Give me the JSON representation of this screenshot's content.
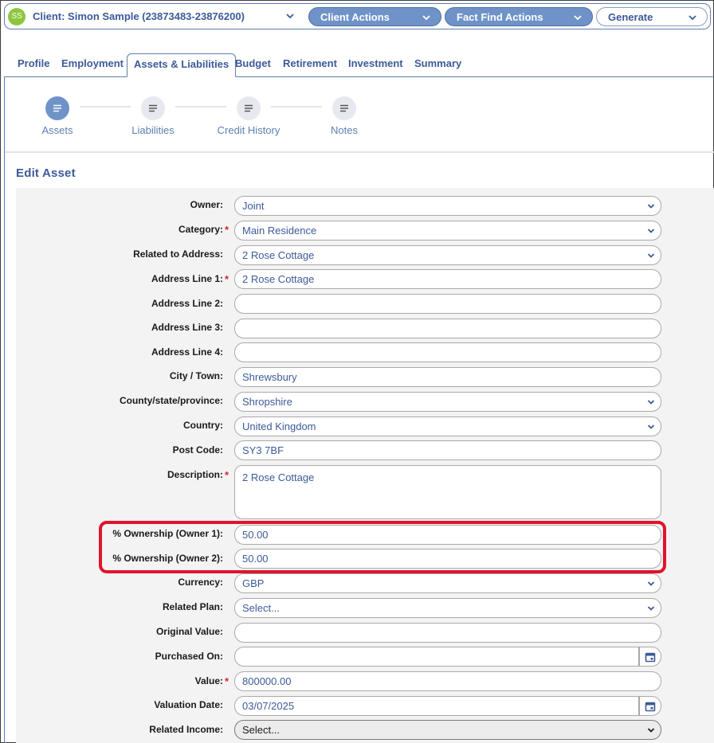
{
  "header": {
    "avatar_initials": "SS",
    "client_label": "Client: Simon Sample (23873483-23876200)",
    "client_actions": "Client Actions",
    "fact_find_actions": "Fact Find Actions",
    "generate": "Generate",
    "accent_color": "#6f93c8"
  },
  "tabs": [
    {
      "label": "Profile",
      "active": false
    },
    {
      "label": "Employment",
      "active": false
    },
    {
      "label": "Assets & Liabilities",
      "active": true
    },
    {
      "label": "Budget",
      "active": false
    },
    {
      "label": "Retirement",
      "active": false
    },
    {
      "label": "Investment",
      "active": false
    },
    {
      "label": "Summary",
      "active": false
    }
  ],
  "stepper": [
    {
      "label": "Assets",
      "icon": "list-icon",
      "active": true
    },
    {
      "label": "Liabilities",
      "icon": "list-icon",
      "active": false
    },
    {
      "label": "Credit History",
      "icon": "list-icon",
      "active": false
    },
    {
      "label": "Notes",
      "icon": "list-icon",
      "active": false
    }
  ],
  "form": {
    "title": "Edit Asset",
    "fields": {
      "owner": {
        "label": "Owner:",
        "value": "Joint"
      },
      "category": {
        "label": "Category:",
        "value": "Main Residence",
        "required": "*"
      },
      "related_address": {
        "label": "Related to Address:",
        "value": "2 Rose Cottage"
      },
      "address1": {
        "label": "Address Line 1:",
        "value": "2 Rose Cottage",
        "required": "*"
      },
      "address2": {
        "label": "Address Line 2:",
        "value": ""
      },
      "address3": {
        "label": "Address Line 3:",
        "value": ""
      },
      "address4": {
        "label": "Address Line 4:",
        "value": ""
      },
      "city": {
        "label": "City / Town:",
        "value": "Shrewsbury"
      },
      "county": {
        "label": "County/state/province:",
        "value": "Shropshire"
      },
      "country": {
        "label": "Country:",
        "value": "United Kingdom"
      },
      "postcode": {
        "label": "Post Code:",
        "value": "SY3 7BF"
      },
      "description": {
        "label": "Description:",
        "value": "2 Rose Cottage",
        "required": "*"
      },
      "ownership1": {
        "label": "% Ownership (Owner 1):",
        "value": "50.00"
      },
      "ownership2": {
        "label": "% Ownership (Owner 2):",
        "value": "50.00"
      },
      "currency": {
        "label": "Currency:",
        "value": "GBP"
      },
      "related_plan": {
        "label": "Related Plan:",
        "value": "Select..."
      },
      "original_value": {
        "label": "Original Value:",
        "value": ""
      },
      "purchased_on": {
        "label": "Purchased On:",
        "value": ""
      },
      "value": {
        "label": "Value:",
        "value": "800000.00",
        "required": "*"
      },
      "valuation_date": {
        "label": "Valuation Date:",
        "value": "03/07/2025"
      },
      "related_income": {
        "label": "Related Income:",
        "value": "Select..."
      }
    }
  },
  "highlight_color": "#e0142c"
}
